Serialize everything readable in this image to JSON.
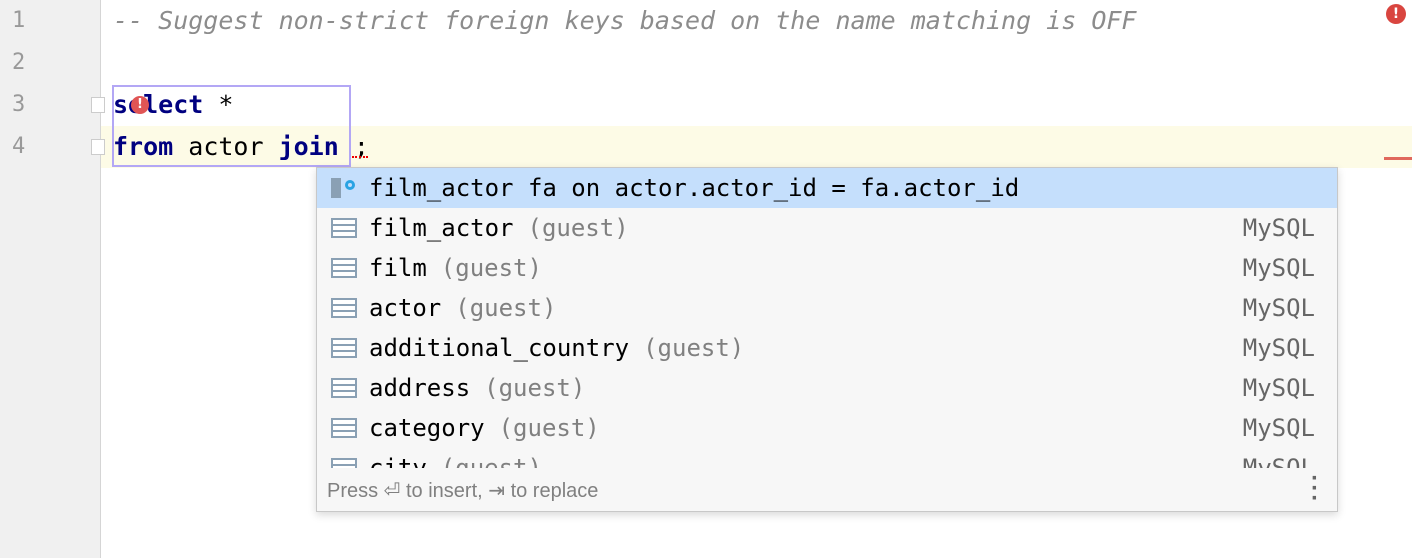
{
  "editor": {
    "line_numbers": [
      "1",
      "2",
      "3",
      "4"
    ],
    "line1": "-- Suggest non-strict foreign keys based on the name matching is OFF",
    "line3_kw": "select",
    "line3_rest": " *",
    "line4_kw1": "from",
    "line4_mid": " actor ",
    "line4_kw2": "join",
    "line4_end": " ;"
  },
  "completion": {
    "items": [
      {
        "name": "film_actor fa on actor.actor_id = fa.actor_id",
        "schema": "",
        "source": "",
        "icon": "foreign-key-join-icon"
      },
      {
        "name": "film_actor",
        "schema": "(guest)",
        "source": "MySQL",
        "icon": "table-icon"
      },
      {
        "name": "film",
        "schema": "(guest)",
        "source": "MySQL",
        "icon": "table-icon"
      },
      {
        "name": "actor",
        "schema": "(guest)",
        "source": "MySQL",
        "icon": "table-icon"
      },
      {
        "name": "additional_country",
        "schema": "(guest)",
        "source": "MySQL",
        "icon": "table-icon"
      },
      {
        "name": "address",
        "schema": "(guest)",
        "source": "MySQL",
        "icon": "table-icon"
      },
      {
        "name": "category",
        "schema": "(guest)",
        "source": "MySQL",
        "icon": "table-icon"
      },
      {
        "name": "city",
        "schema": "(guest)",
        "source": "MySQL",
        "icon": "table-icon"
      }
    ],
    "footer": "Press ⏎ to insert, ⇥ to replace"
  }
}
